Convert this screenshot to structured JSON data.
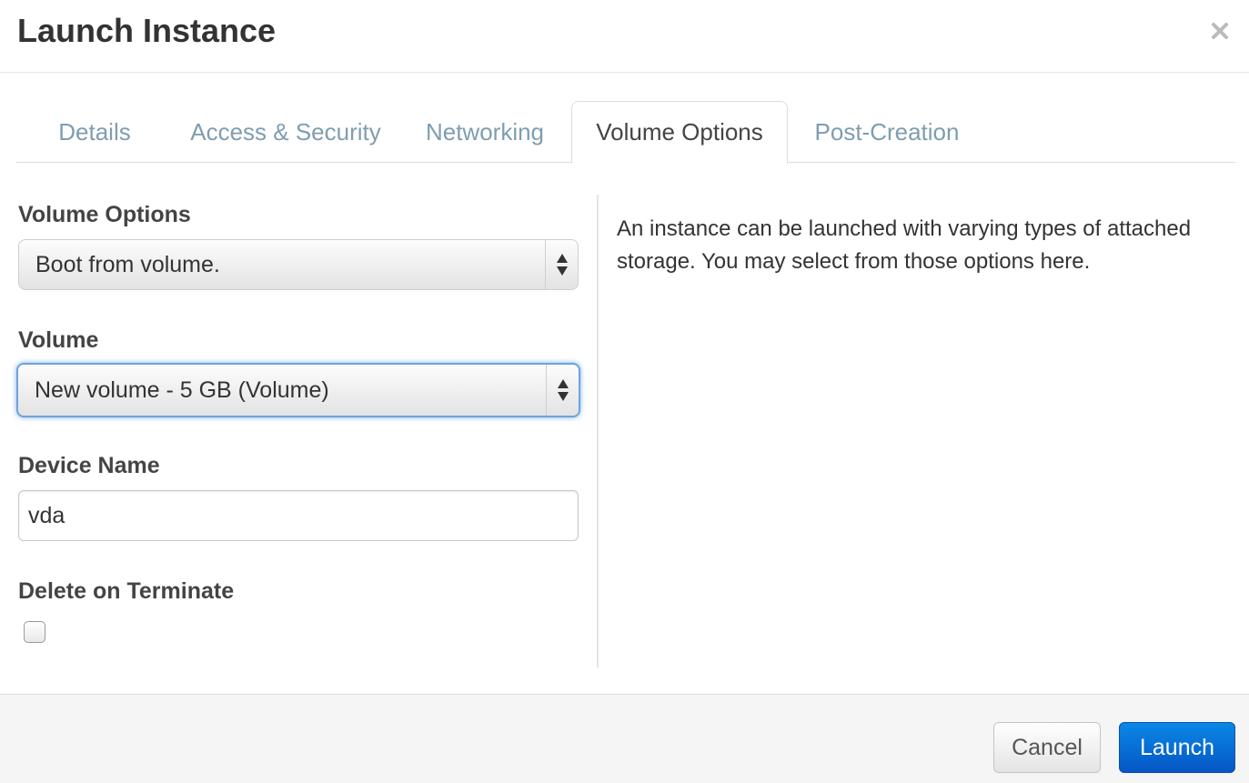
{
  "modal": {
    "title": "Launch Instance",
    "close_symbol": "×"
  },
  "tabs": [
    {
      "label": "Details",
      "active": false
    },
    {
      "label": "Access & Security",
      "active": false
    },
    {
      "label": "Networking",
      "active": false
    },
    {
      "label": "Volume Options",
      "active": true
    },
    {
      "label": "Post-Creation",
      "active": false
    }
  ],
  "form": {
    "volume_options": {
      "label": "Volume Options",
      "selected": "Boot from volume."
    },
    "volume": {
      "label": "Volume",
      "selected": "New volume - 5 GB (Volume)"
    },
    "device_name": {
      "label": "Device Name",
      "value": "vda"
    },
    "delete_on_terminate": {
      "label": "Delete on Terminate",
      "checked": false
    }
  },
  "help": {
    "text": "An instance can be launched with varying types of attached storage. You may select from those options here."
  },
  "footer": {
    "cancel_label": "Cancel",
    "launch_label": "Launch"
  },
  "colors": {
    "tab_inactive": "#7f9db0",
    "focus_ring": "#6fa2dc",
    "primary_button": "#0a6fd8"
  },
  "icons": {
    "close": "close-icon",
    "select_arrows": "updown-arrows-icon"
  }
}
